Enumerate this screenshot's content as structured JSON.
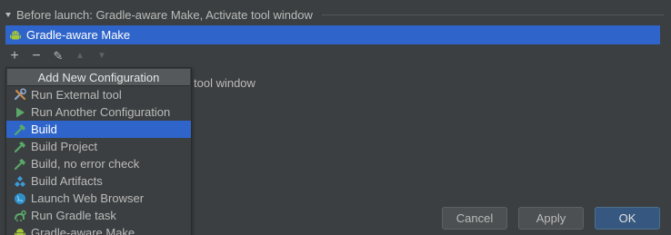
{
  "section": {
    "title": "Before launch: Gradle-aware Make, Activate tool window"
  },
  "task_list": {
    "items": [
      {
        "label": "Gradle-aware Make",
        "icon": "android-icon"
      }
    ]
  },
  "toolbar": {
    "add": "+",
    "remove": "−",
    "edit": "✎",
    "up": "▲",
    "down": "▼"
  },
  "background_text": "tool window",
  "popup": {
    "header": "Add New Configuration",
    "items": [
      {
        "label": "Run External tool",
        "icon": "tools-icon"
      },
      {
        "label": "Run Another Configuration",
        "icon": "run-icon"
      },
      {
        "label": "Build",
        "icon": "hammer-icon",
        "selected": true
      },
      {
        "label": "Build Project",
        "icon": "hammer-icon"
      },
      {
        "label": "Build, no error check",
        "icon": "hammer-icon"
      },
      {
        "label": "Build Artifacts",
        "icon": "artifacts-icon"
      },
      {
        "label": "Launch Web Browser",
        "icon": "globe-icon"
      },
      {
        "label": "Run Gradle task",
        "icon": "gradle-icon"
      },
      {
        "label": "Gradle-aware Make",
        "icon": "android-icon"
      }
    ]
  },
  "buttons": {
    "cancel": "Cancel",
    "apply": "Apply",
    "ok": "OK"
  },
  "colors": {
    "background": "#3c3f41",
    "selection": "#2f65ca",
    "popup_header": "#55595c",
    "ok_button": "#365880"
  }
}
